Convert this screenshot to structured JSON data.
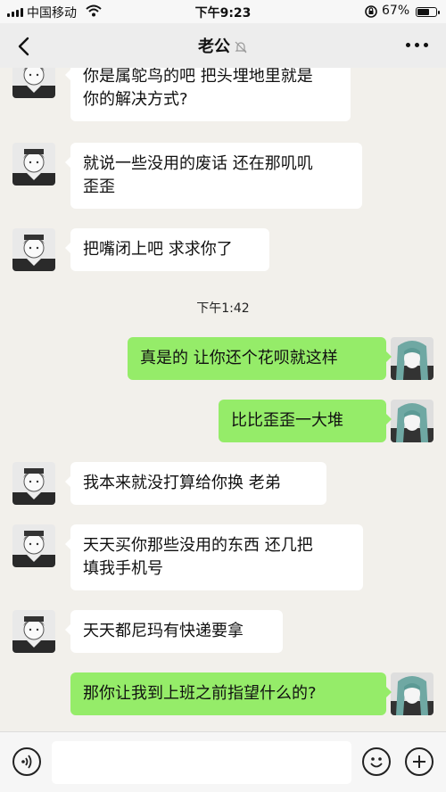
{
  "status_bar": {
    "carrier": "中国移动",
    "time": "下午9:23",
    "battery_percent": "67%",
    "battery_level": 0.67
  },
  "header": {
    "title": "老公",
    "muted": true
  },
  "messages": [
    {
      "side": "in",
      "text": "你是属鸵鸟的吧 把头埋地里就是\n你的解决方式?"
    },
    {
      "side": "in",
      "text": "就说一些没用的废话 还在那叽叽\n歪歪"
    },
    {
      "side": "in",
      "text": "把嘴闭上吧 求求你了"
    },
    {
      "type": "time",
      "text": "下午1:42"
    },
    {
      "side": "out",
      "text": "真是的 让你还个花呗就这样"
    },
    {
      "side": "out",
      "text": "比比歪歪一大堆"
    },
    {
      "side": "in",
      "text": "我本来就没打算给你换 老弟"
    },
    {
      "side": "in",
      "text": "天天买你那些没用的东西 还几把\n填我手机号"
    },
    {
      "side": "in",
      "text": "天天都尼玛有快递要拿"
    },
    {
      "side": "out",
      "text": "那你让我到上班之前指望什么的?"
    }
  ],
  "input_bar": {
    "voice_icon": "voice-icon",
    "emoji_icon": "emoji-icon",
    "plus_icon": "plus-icon",
    "text_value": ""
  },
  "colors": {
    "chat_bg": "#f2f0eb",
    "incoming_bubble": "#ffffff",
    "outgoing_bubble": "#95ec69"
  }
}
